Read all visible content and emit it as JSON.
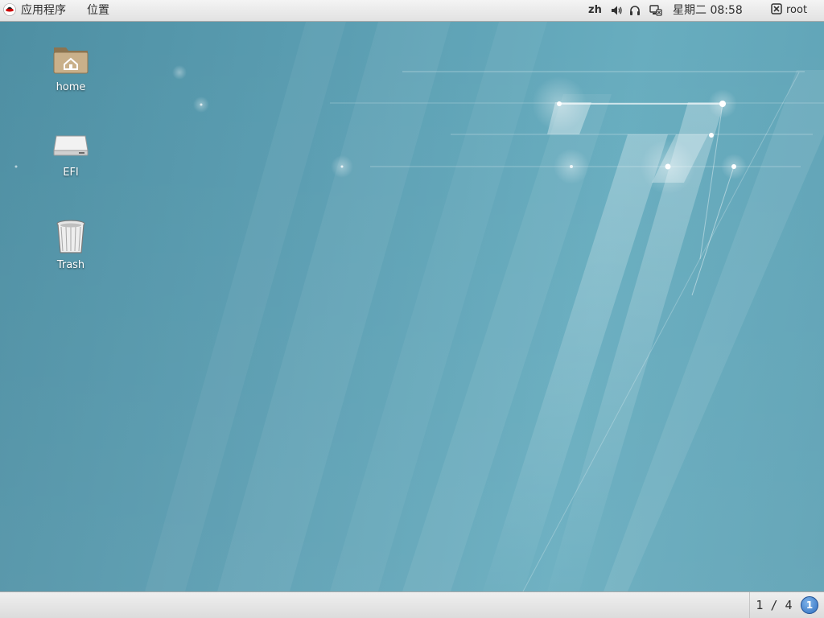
{
  "top_panel": {
    "applications_label": "应用程序",
    "places_label": "位置",
    "language": "zh",
    "clock": "星期二 08:58",
    "user": "root"
  },
  "desktop": {
    "icons": [
      {
        "label": "home",
        "icon": "home-folder-icon"
      },
      {
        "label": "EFI",
        "icon": "drive-icon"
      },
      {
        "label": "Trash",
        "icon": "trash-icon"
      }
    ]
  },
  "bottom_panel": {
    "workspace": "1 / 4",
    "notifications_count": "1"
  },
  "colors": {
    "panel_bg": "#e8e8e8",
    "desktop_bg": "#5f9fb3",
    "badge": "#2f6fc0"
  }
}
